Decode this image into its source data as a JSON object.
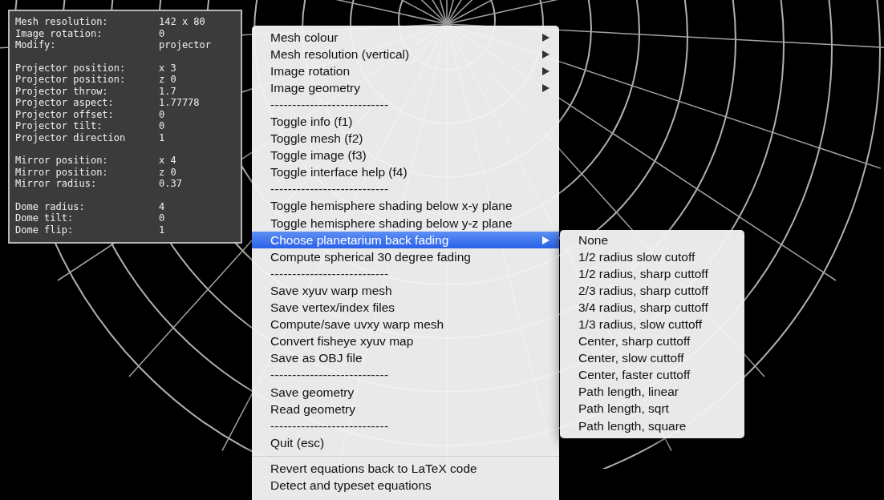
{
  "info_panel": {
    "groups": [
      {
        "rows": [
          {
            "label": "Mesh resolution:",
            "value": "142 x 80"
          },
          {
            "label": "Image rotation:",
            "value": "0"
          },
          {
            "label": "Modify:",
            "value": "projector"
          }
        ]
      },
      {
        "rows": [
          {
            "label": "Projector position:",
            "value": "x 3"
          },
          {
            "label": "Projector position:",
            "value": "z 0"
          },
          {
            "label": "Projector throw:",
            "value": "1.7"
          },
          {
            "label": "Projector aspect:",
            "value": "1.77778"
          },
          {
            "label": "Projector offset:",
            "value": "0"
          },
          {
            "label": "Projector tilt:",
            "value": "0"
          },
          {
            "label": "Projector direction",
            "value": "1"
          }
        ]
      },
      {
        "rows": [
          {
            "label": "Mirror position:",
            "value": "x 4"
          },
          {
            "label": "Mirror position:",
            "value": "z 0"
          },
          {
            "label": "Mirror radius:",
            "value": "0.37"
          }
        ]
      },
      {
        "rows": [
          {
            "label": "Dome radius:",
            "value": "4"
          },
          {
            "label": "Dome tilt:",
            "value": "0"
          },
          {
            "label": "Dome flip:",
            "value": "1"
          }
        ]
      }
    ]
  },
  "context_menu": {
    "items": [
      {
        "kind": "item",
        "label": "Mesh colour",
        "has_submenu": true,
        "selected": false
      },
      {
        "kind": "item",
        "label": "Mesh resolution (vertical)",
        "has_submenu": true,
        "selected": false
      },
      {
        "kind": "item",
        "label": "Image rotation",
        "has_submenu": true,
        "selected": false
      },
      {
        "kind": "item",
        "label": "Image geometry",
        "has_submenu": true,
        "selected": false
      },
      {
        "kind": "dashes",
        "label": "---------------------------"
      },
      {
        "kind": "item",
        "label": "Toggle info (f1)",
        "has_submenu": false,
        "selected": false
      },
      {
        "kind": "item",
        "label": "Toggle mesh (f2)",
        "has_submenu": false,
        "selected": false
      },
      {
        "kind": "item",
        "label": "Toggle image (f3)",
        "has_submenu": false,
        "selected": false
      },
      {
        "kind": "item",
        "label": "Toggle interface help (f4)",
        "has_submenu": false,
        "selected": false
      },
      {
        "kind": "dashes",
        "label": "---------------------------"
      },
      {
        "kind": "item",
        "label": "Toggle hemisphere shading below x-y plane",
        "has_submenu": false,
        "selected": false
      },
      {
        "kind": "item",
        "label": "Toggle hemisphere shading below y-z plane",
        "has_submenu": false,
        "selected": false
      },
      {
        "kind": "item",
        "label": "Choose planetarium back fading",
        "has_submenu": true,
        "selected": true
      },
      {
        "kind": "item",
        "label": "Compute spherical 30 degree fading",
        "has_submenu": false,
        "selected": false
      },
      {
        "kind": "dashes",
        "label": "---------------------------"
      },
      {
        "kind": "item",
        "label": "Save xyuv warp mesh",
        "has_submenu": false,
        "selected": false
      },
      {
        "kind": "item",
        "label": "Save vertex/index files",
        "has_submenu": false,
        "selected": false
      },
      {
        "kind": "item",
        "label": "Compute/save uvxy warp mesh",
        "has_submenu": false,
        "selected": false
      },
      {
        "kind": "item",
        "label": "Convert fisheye xyuv map",
        "has_submenu": false,
        "selected": false
      },
      {
        "kind": "item",
        "label": "Save as OBJ file",
        "has_submenu": false,
        "selected": false
      },
      {
        "kind": "dashes",
        "label": "---------------------------"
      },
      {
        "kind": "item",
        "label": "Save geometry",
        "has_submenu": false,
        "selected": false
      },
      {
        "kind": "item",
        "label": "Read geometry",
        "has_submenu": false,
        "selected": false
      },
      {
        "kind": "dashes",
        "label": "---------------------------"
      },
      {
        "kind": "item",
        "label": "Quit (esc)",
        "has_submenu": false,
        "selected": false
      },
      {
        "kind": "separator"
      },
      {
        "kind": "item",
        "label": "Revert equations back to LaTeX code",
        "has_submenu": false,
        "selected": false
      },
      {
        "kind": "item",
        "label": "Detect and typeset equations",
        "has_submenu": false,
        "selected": false
      }
    ]
  },
  "submenu": {
    "items": [
      {
        "label": "None",
        "selected": false
      },
      {
        "label": "1/2 radius slow cutoff",
        "selected": false
      },
      {
        "label": "1/2 radius, sharp cuttoff",
        "selected": false
      },
      {
        "label": "2/3 radius, sharp cuttoff",
        "selected": false
      },
      {
        "label": "3/4 radius, sharp cuttoff",
        "selected": false
      },
      {
        "label": "1/3 radius, slow cuttoff",
        "selected": false
      },
      {
        "label": "Center, sharp cuttoff",
        "selected": false
      },
      {
        "label": "Center, slow cuttoff",
        "selected": false
      },
      {
        "label": "Center, faster cuttoff",
        "selected": false
      },
      {
        "label": "Path length, linear",
        "selected": false
      },
      {
        "label": "Path length, sqrt",
        "selected": false
      },
      {
        "label": "Path length, square",
        "selected": false
      }
    ]
  }
}
